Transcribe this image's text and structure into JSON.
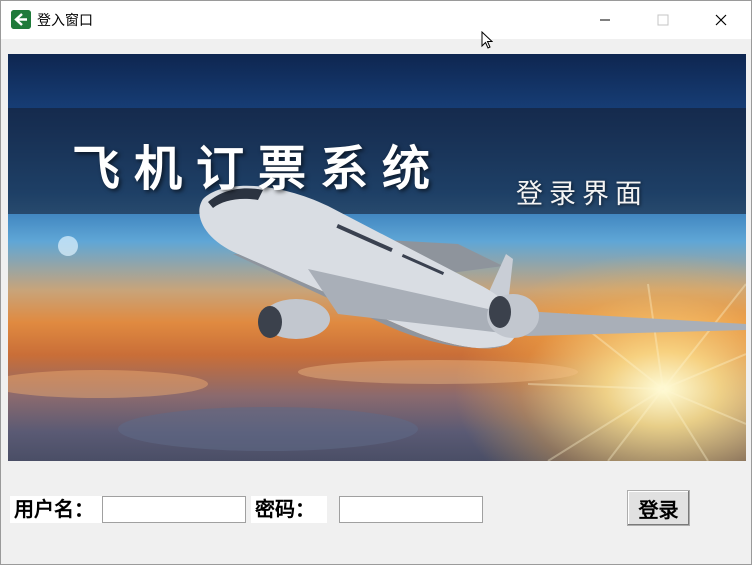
{
  "window": {
    "title": "登入窗口",
    "icon": "back-arrow-icon",
    "controls": [
      "minimize-icon",
      "maximize-icon",
      "close-icon"
    ]
  },
  "banner": {
    "title": "飞机订票系统",
    "subtitle": "登录界面"
  },
  "form": {
    "username_label": "用户名：",
    "username_value": "",
    "password_label": "密码：",
    "password_value": "",
    "login_label": "登录"
  },
  "colors": {
    "title_band": "#141e30",
    "window_bg": "#f0f0f0",
    "icon_green": "#1f7a3a"
  }
}
